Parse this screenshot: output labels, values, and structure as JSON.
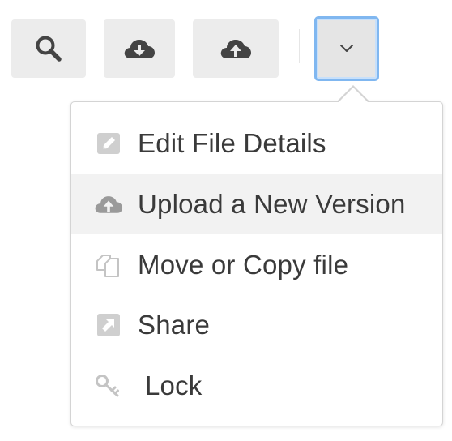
{
  "toolbar": {
    "search_icon": "search-icon",
    "download_icon": "cloud-download-icon",
    "upload_icon": "cloud-upload-icon",
    "more_icon": "chevron-down-icon",
    "more_button_state": "active",
    "accent_color": "#80b7f0"
  },
  "menu": {
    "items": [
      {
        "label": "Edit File Details",
        "icon": "pencil-icon",
        "highlighted": false
      },
      {
        "label": "Upload a New Version",
        "icon": "cloud-upload-icon",
        "highlighted": true
      },
      {
        "label": "Move or Copy file",
        "icon": "copy-icon",
        "highlighted": false
      },
      {
        "label": "Share",
        "icon": "share-arrow-icon",
        "highlighted": false
      },
      {
        "label": "Lock",
        "icon": "key-icon",
        "highlighted": false
      }
    ]
  }
}
